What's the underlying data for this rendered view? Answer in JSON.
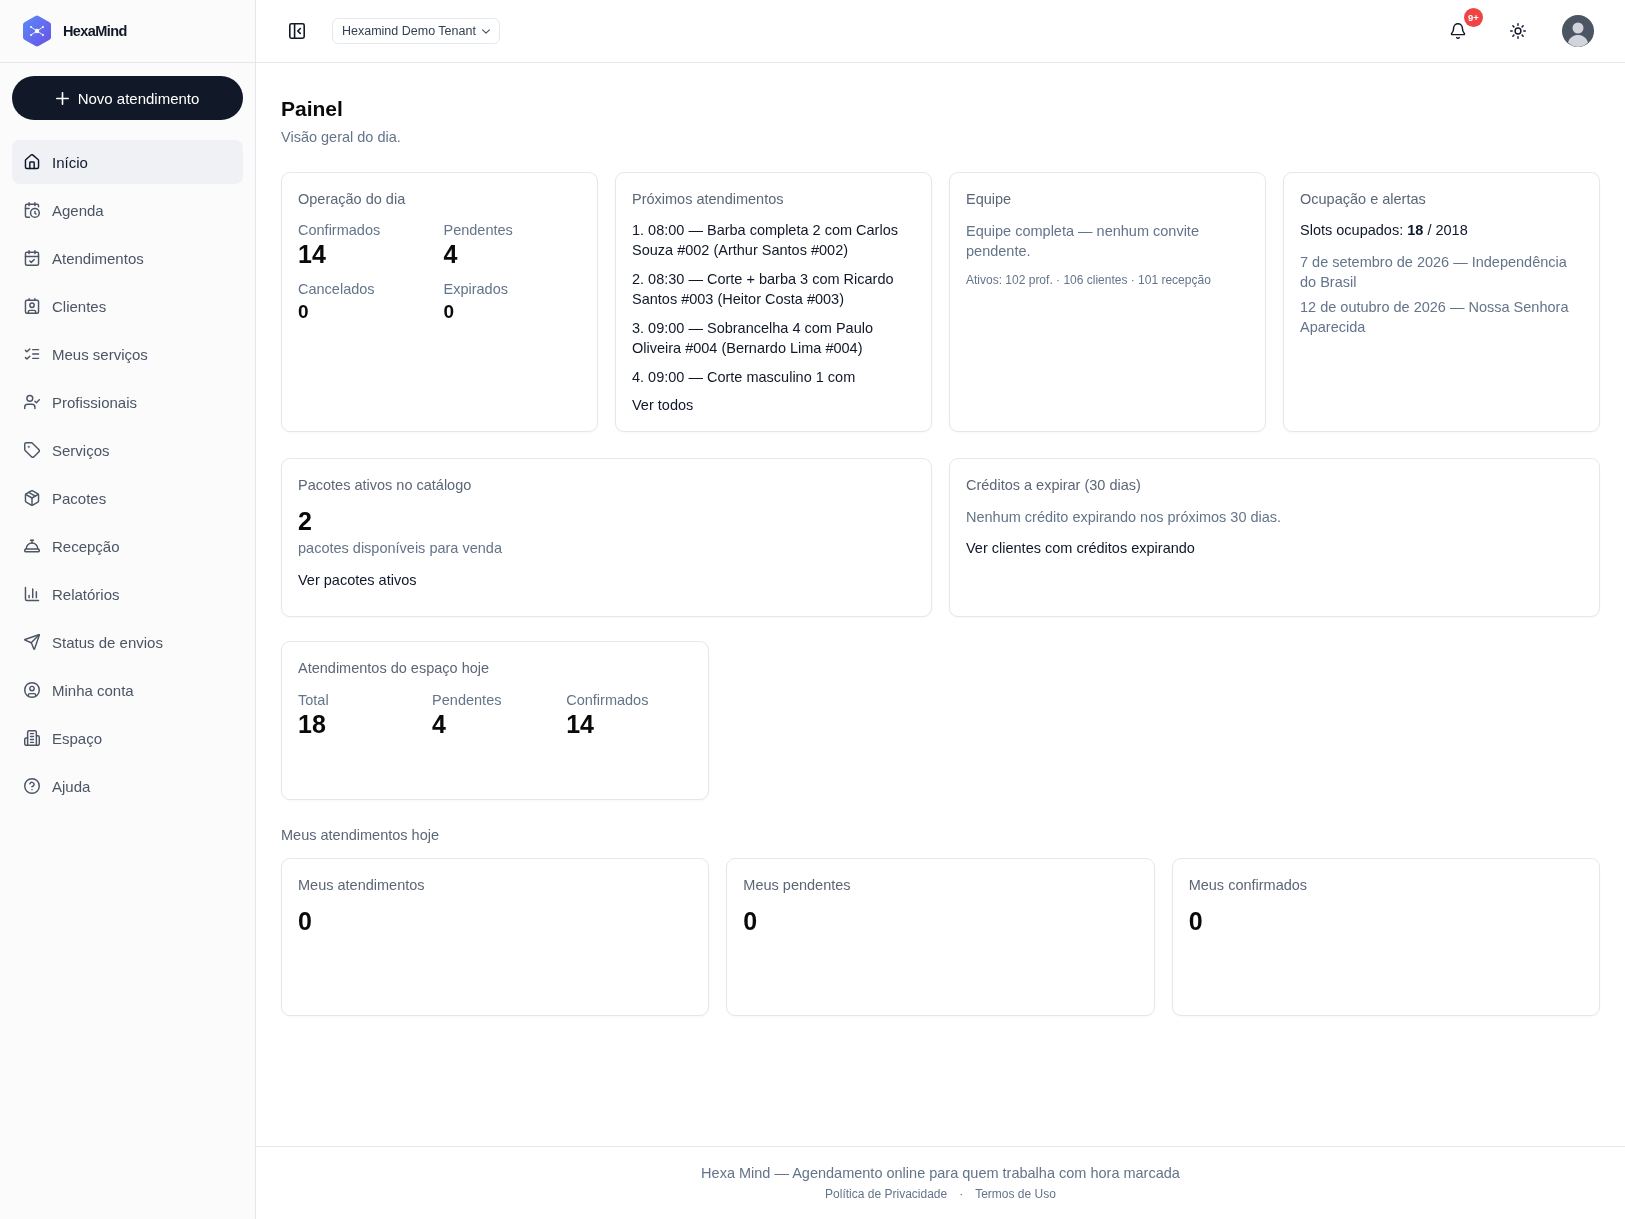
{
  "sidebar": {
    "brand": "HexaMind",
    "new_button": "Novo atendimento",
    "items": [
      {
        "label": "Início",
        "selected": true
      },
      {
        "label": "Agenda",
        "selected": false
      },
      {
        "label": "Atendimentos",
        "selected": false
      },
      {
        "label": "Clientes",
        "selected": false
      },
      {
        "label": "Meus serviços",
        "selected": false
      },
      {
        "label": "Profissionais",
        "selected": false
      },
      {
        "label": "Serviços",
        "selected": false
      },
      {
        "label": "Pacotes",
        "selected": false
      },
      {
        "label": "Recepção",
        "selected": false
      },
      {
        "label": "Relatórios",
        "selected": false
      },
      {
        "label": "Status de envios",
        "selected": false
      },
      {
        "label": "Minha conta",
        "selected": false
      },
      {
        "label": "Espaço",
        "selected": false
      },
      {
        "label": "Ajuda",
        "selected": false
      }
    ]
  },
  "topbar": {
    "tenant": "Hexamind Demo Tenant",
    "notification_count": "9+"
  },
  "page": {
    "title": "Painel",
    "subtitle": "Visão geral do dia."
  },
  "overview_cards": [
    {
      "kind": "stat-grid",
      "title": "Operação do dia",
      "stats": [
        {
          "label": "Confirmados",
          "value": "14",
          "kind": "major"
        },
        {
          "label": "Pendentes",
          "value": "4",
          "kind": "major"
        },
        {
          "label": "Cancelados",
          "value": "0",
          "kind": "minor"
        },
        {
          "label": "Expirados",
          "value": "0",
          "kind": "minor"
        }
      ]
    },
    {
      "kind": "schedule",
      "title": "Próximos atendimentos",
      "items": [
        "1. 08:00 — Barba completa 2 com Carlos Souza #002 (Arthur Santos #002)",
        "2. 08:30 — Corte + barba 3 com Ricardo Santos #003 (Heitor Costa #003)",
        "3. 09:00 — Sobrancelha 4 com Paulo Oliveira #004 (Bernardo Lima #004)",
        "4. 09:00 — Corte masculino 1 com"
      ],
      "link": "Ver todos"
    },
    {
      "kind": "note",
      "title": "Equipe",
      "text": "Equipe completa — nenhum convite pendente.",
      "detail": "Ativos: 102 prof. · 106 clientes · 101 recepção"
    },
    {
      "kind": "alerts",
      "title": "Ocupação e alertas",
      "summary": "Slots ocupados: **18** / 2018",
      "items": [
        "7 de setembro de 2026 — Independência do Brasil",
        "12 de outubro de 2026 — Nossa Senhora Aparecida"
      ]
    }
  ],
  "highlight_cards": [
    {
      "kind": "metric",
      "title": "Pacotes ativos no catálogo",
      "value": "2",
      "caption": "pacotes disponíveis para venda",
      "link": "Ver pacotes ativos"
    },
    {
      "kind": "note",
      "title": "Créditos a expirar (30 dias)",
      "text": "Nenhum crédito expirando nos próximos 30 dias.",
      "link": "Ver clientes com créditos expirando"
    }
  ],
  "space_cards": [
    {
      "kind": "stat-row",
      "title": "Atendimentos do espaço hoje",
      "stats": [
        {
          "label": "Total",
          "value": "18",
          "kind": "major"
        },
        {
          "label": "Pendentes",
          "value": "4",
          "kind": "major"
        },
        {
          "label": "Confirmados",
          "value": "14",
          "kind": "major"
        }
      ]
    }
  ],
  "my_day": {
    "heading": "Meus atendimentos hoje",
    "cards": [
      {
        "kind": "metric",
        "title": "Meus atendimentos",
        "value": "0"
      },
      {
        "kind": "metric",
        "title": "Meus pendentes",
        "value": "0"
      },
      {
        "kind": "metric",
        "title": "Meus confirmados",
        "value": "0"
      }
    ]
  },
  "footer": {
    "text": "Hexa Mind — Agendamento online para quem trabalha com hora marcada",
    "links": [
      "Política de Privacidade",
      "Termos de Uso"
    ],
    "separator": "·"
  }
}
